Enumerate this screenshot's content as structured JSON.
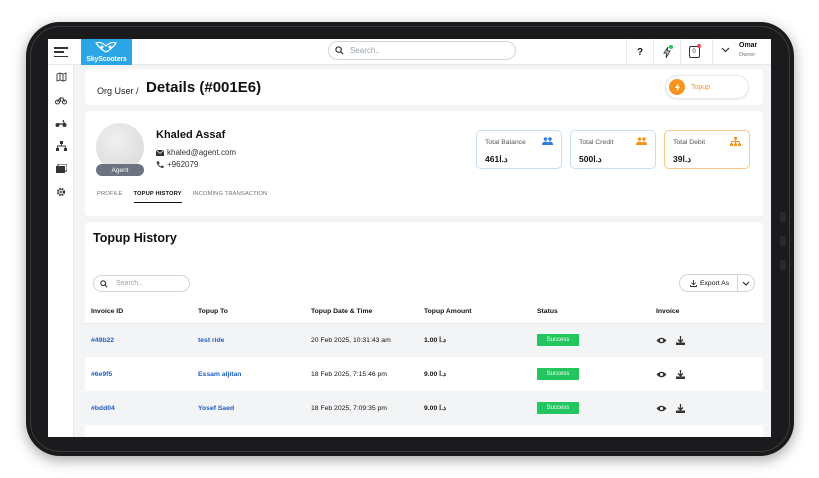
{
  "topbar": {
    "logo_text": "SkyScooters",
    "search_placeholder": "Search..",
    "help_label": "?",
    "notif_count": "0",
    "user_name": "Omar",
    "user_role": "Owner"
  },
  "header": {
    "breadcrumb": "Org User /",
    "title": "Details (#001E6)",
    "topup_label": "Topup"
  },
  "profile": {
    "name": "Khaled Assaf",
    "email": "khaled@agent.com",
    "phone": "+962079",
    "role_badge": "Agent",
    "tabs": [
      "PROFILE",
      "TOPUP HISTORY",
      "INCOMING TRANSACTION"
    ],
    "active_tab": "TOPUP HISTORY"
  },
  "stats": [
    {
      "label": "Total Balance",
      "value": "461",
      "currency": "د.ا",
      "icon": "users-icon",
      "color": "#2b7fd9"
    },
    {
      "label": "Total Credit",
      "value": "500",
      "currency": "د.ا",
      "icon": "users-icon",
      "color": "#f7941d"
    },
    {
      "label": "Total Debit",
      "value": "39",
      "currency": "د.ا",
      "icon": "sitemap-icon",
      "color": "#f7941d"
    }
  ],
  "history": {
    "title": "Topup History",
    "search_placeholder": "Search..",
    "export_label": "Export As",
    "columns": [
      "Invoice ID",
      "Topup To",
      "Topup Date & Time",
      "Topup Amount",
      "Status",
      "Invoice"
    ],
    "rows": [
      {
        "invoice_id": "#49b22",
        "topup_to": "test ride",
        "datetime": "20 Feb 2025, 10:31:43 am",
        "amount": "1.00",
        "currency": "د.ا",
        "status": "Success"
      },
      {
        "invoice_id": "#6e9f5",
        "topup_to": "Essam aljitan",
        "datetime": "18 Feb 2025, 7:15:46 pm",
        "amount": "9.00",
        "currency": "د.ا",
        "status": "Success"
      },
      {
        "invoice_id": "#bdd04",
        "topup_to": "Yosef Saed",
        "datetime": "18 Feb 2025, 7:09:35 pm",
        "amount": "9.00",
        "currency": "د.ا",
        "status": "Success"
      }
    ]
  },
  "colors": {
    "accent": "#2aa5e6",
    "orange": "#f7941d",
    "success": "#22c55e",
    "link": "#1d5fc7"
  }
}
